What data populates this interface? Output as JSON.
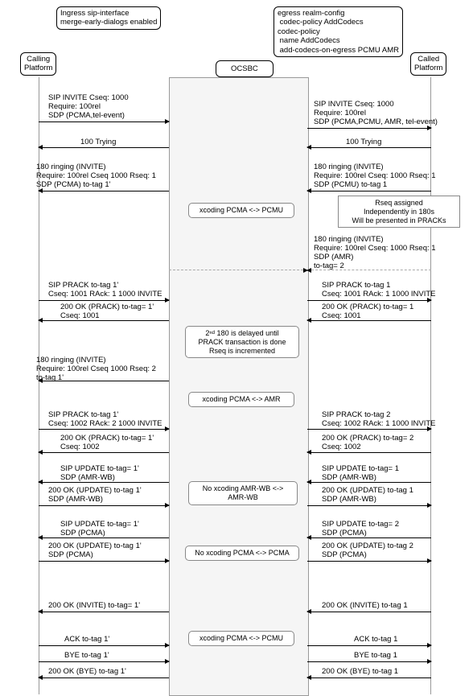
{
  "ingress": {
    "line1": "Ingress sip-interface",
    "line2": "merge-early-dialogs enabled"
  },
  "egress": {
    "line1": "egress realm-config",
    "line2": "codec-policy AddCodecs",
    "line3": "codec-policy",
    "line4": "name AddCodecs",
    "line5": "add-codecs-on-egress PCMU AMR"
  },
  "headers": {
    "calling1": "Calling",
    "calling2": "Platform",
    "ocsbc": "OCSBC",
    "called1": "Called",
    "called2": "Platform"
  },
  "left": {
    "m0": {
      "l0": "SIP INVITE Cseq: 1000",
      "l1": "Require: 100rel",
      "l2": "SDP (PCMA,tel-event)"
    },
    "m1": {
      "l0": "100 Trying"
    },
    "m2": {
      "l0": "180 ringing (INVITE)",
      "l1": "Require: 100rel Cseq 1000 Rseq: 1",
      "l2": "SDP (PCMA)   to-tag 1'"
    },
    "m3": {
      "l0": "SIP PRACK   to-tag 1'",
      "l1": "Cseq: 1001 RAck: 1 1000 INVITE"
    },
    "m4": {
      "l0": "200 OK (PRACK) to-tag= 1'",
      "l1": "Cseq: 1001"
    },
    "m5": {
      "l0": "180 ringing (INVITE)",
      "l1": "Require: 100rel Cseq 1000 Rseq: 2",
      "l2": "to-tag 1'"
    },
    "m6": {
      "l0": "SIP PRACK   to-tag 1'",
      "l1": "Cseq: 1002 RAck: 2 1000 INVITE"
    },
    "m7": {
      "l0": "200 OK (PRACK) to-tag= 1'",
      "l1": "Cseq: 1002"
    },
    "m8": {
      "l0": "SIP UPDATE   to-tag= 1'",
      "l1": "SDP (AMR-WB)"
    },
    "m9": {
      "l0": "200 OK (UPDATE)   to-tag 1'",
      "l1": "SDP (AMR-WB)"
    },
    "m10": {
      "l0": "SIP UPDATE   to-tag= 1'",
      "l1": "SDP (PCMA)"
    },
    "m11": {
      "l0": "200 OK (UPDATE)   to-tag 1'",
      "l1": "SDP (PCMA)"
    },
    "m12": {
      "l0": "200 OK (INVITE)   to-tag= 1'"
    },
    "m13": {
      "l0": "ACK   to-tag 1'"
    },
    "m14": {
      "l0": "BYE   to-tag 1'"
    },
    "m15": {
      "l0": "200 OK (BYE)   to-tag 1'"
    }
  },
  "right": {
    "m0": {
      "l0": "SIP INVITE Cseq: 1000",
      "l1": "Require: 100rel",
      "l2": "SDP (PCMA,PCMU, AMR, tel-event)"
    },
    "m1": {
      "l0": "100 Trying"
    },
    "m2": {
      "l0": "180 ringing (INVITE)",
      "l1": "Require: 100rel Cseq: 1000 Rseq: 1",
      "l2": "SDP (PCMU)   to-tag 1"
    },
    "m3": {
      "l0": "180 ringing (INVITE)",
      "l1": "Require: 100rel Cseq: 1000 Rseq: 1",
      "l2": "SDP (AMR)",
      "l3": "to-tag= 2"
    },
    "m4": {
      "l0": "SIP PRACK   to-tag 1",
      "l1": "Cseq: 1001 RAck: 1 1000 INVITE"
    },
    "m5": {
      "l0": "200 OK (PRACK) to-tag= 1",
      "l1": "Cseq: 1001"
    },
    "m6": {
      "l0": "SIP PRACK   to-tag 2",
      "l1": "Cseq: 1002 RAck: 1 1000 INVITE"
    },
    "m7": {
      "l0": "200 OK (PRACK) to-tag= 2",
      "l1": "Cseq: 1002"
    },
    "m8": {
      "l0": "SIP UPDATE   to-tag= 1",
      "l1": "SDP (AMR-WB)"
    },
    "m9": {
      "l0": "200 OK (UPDATE)   to-tag 1",
      "l1": "SDP (AMR-WB)"
    },
    "m10": {
      "l0": "SIP UPDATE   to-tag= 2",
      "l1": "SDP (PCMA)"
    },
    "m11": {
      "l0": "200 OK (UPDATE)   to-tag 2",
      "l1": "SDP (PCMA)"
    },
    "m12": {
      "l0": "200 OK (INVITE)   to-tag 1"
    },
    "m13": {
      "l0": "ACK   to-tag 1"
    },
    "m14": {
      "l0": "BYE   to-tag 1"
    },
    "m15": {
      "l0": "200 OK (BYE)   to-tag 1"
    }
  },
  "notes": {
    "n0": "xcoding PCMA <-> PCMU",
    "n1l0": "2ⁿᵈ 180 is delayed until",
    "n1l1": "PRACK transaction is done",
    "n1l2": "Rseq is incremented",
    "n2": "xcoding PCMA <-> AMR",
    "n3l0": "No xcoding AMR-WB <->",
    "n3l1": "AMR-WB",
    "n4": "No xcoding PCMA <-> PCMA",
    "n5": "xcoding PCMA <-> PCMU",
    "rseq0": "Rseq assigned",
    "rseq1": "Independently in 180s",
    "rseq2": "Will be presented in PRACKs"
  }
}
